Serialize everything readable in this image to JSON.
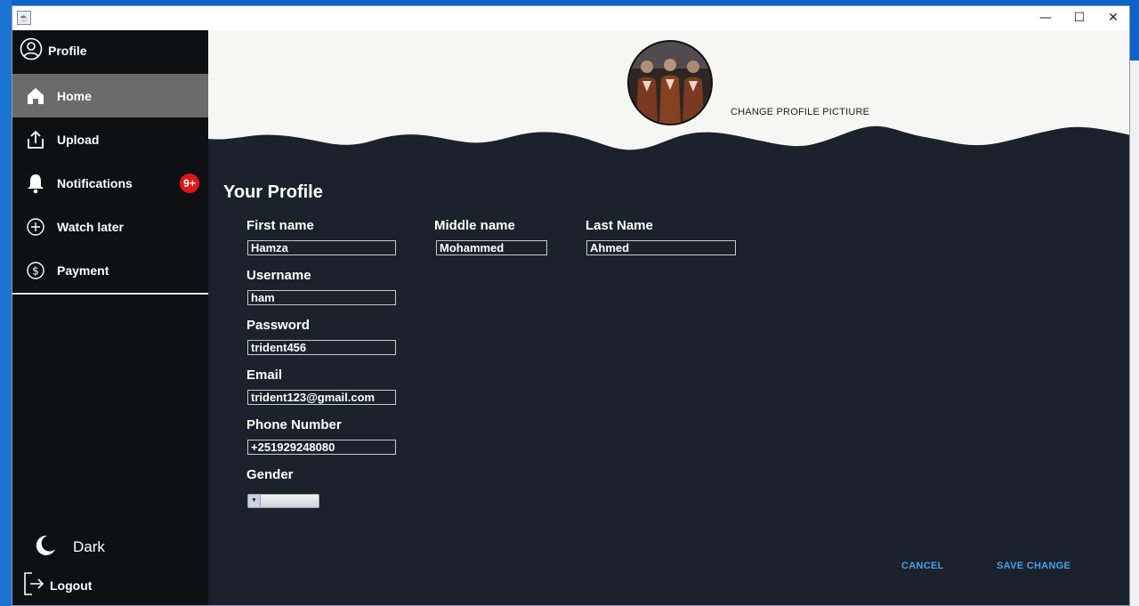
{
  "window": {
    "minimize": "—",
    "maximize": "☐",
    "close": "✕"
  },
  "sidebar": {
    "profile_label": "Profile",
    "items": [
      {
        "label": "Home",
        "icon": "home-icon",
        "active": true
      },
      {
        "label": "Upload",
        "icon": "upload-icon",
        "active": false
      },
      {
        "label": "Notifications",
        "icon": "bell-icon",
        "active": false,
        "badge": "9+"
      },
      {
        "label": "Watch later",
        "icon": "plus-circle-icon",
        "active": false
      },
      {
        "label": "Payment",
        "icon": "dollar-circle-icon",
        "active": false
      }
    ],
    "theme_label": "Dark",
    "logout_label": "Logout"
  },
  "header": {
    "change_picture_label": "CHANGE PROFILE PICTIURE"
  },
  "form": {
    "title": "Your Profile",
    "first_name": {
      "label": "First name",
      "value": "Hamza"
    },
    "middle_name": {
      "label": "Middle name",
      "value": "Mohammed"
    },
    "last_name": {
      "label": "Last Name",
      "value": "Ahmed"
    },
    "username": {
      "label": "Username",
      "value": "ham"
    },
    "password": {
      "label": "Password",
      "value": "trident456"
    },
    "email": {
      "label": "Email",
      "value": "trident123@gmail.com"
    },
    "phone": {
      "label": "Phone Number",
      "value": "+251929248080"
    },
    "gender": {
      "label": "Gender",
      "value": ""
    }
  },
  "actions": {
    "cancel_label": "CANCEL",
    "save_label": "SAVE CHANGE"
  },
  "colors": {
    "sidebar_bg": "#0e1013",
    "main_bg": "#1c222c",
    "header_bg": "#f6f6f4",
    "active_item": "#6b6b6b",
    "badge": "#e11616",
    "action_text": "#4a9fe8"
  }
}
